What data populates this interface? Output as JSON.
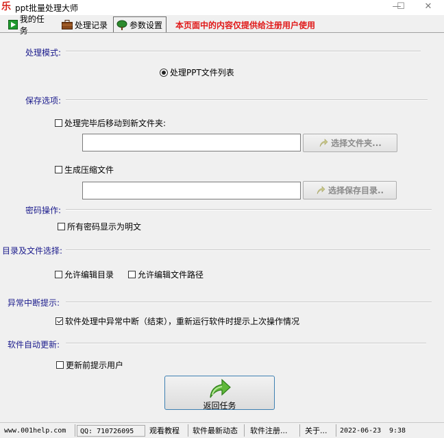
{
  "window": {
    "title": "ppt批量处理大师",
    "icon_glyph": "乐",
    "minimize": "—",
    "maximize": "☐",
    "close": "✕"
  },
  "tabs": [
    {
      "label": "我的任务",
      "icon": "play-icon"
    },
    {
      "label": "处理记录",
      "icon": "briefcase-icon"
    },
    {
      "label": "参数设置",
      "icon": "tree-icon",
      "active": true
    }
  ],
  "notice": "本页面中的内容仅提供给注册用户使用",
  "sections": {
    "mode": {
      "title": "处理模式:",
      "radio_label": "处理PPT文件列表",
      "radio_checked": true
    },
    "save": {
      "title": "保存选项:",
      "move_label": "处理完毕后移动到新文件夹:",
      "move_checked": false,
      "move_path": "",
      "move_button": "选择文件夹...",
      "zip_label": "生成压缩文件",
      "zip_checked": false,
      "zip_path": "",
      "zip_button": "选择保存目录.."
    },
    "password": {
      "title": "密码操作:",
      "plain_label": "所有密码显示为明文",
      "plain_checked": false
    },
    "dir": {
      "title": "目录及文件选择:",
      "edit_dir_label": "允许编辑目录",
      "edit_dir_checked": false,
      "edit_path_label": "允许编辑文件路径",
      "edit_path_checked": false
    },
    "abnormal": {
      "title": "异常中断提示:",
      "notify_label": "软件处理中异常中断（结束），重新运行软件时提示上次操作情况",
      "notify_checked": true
    },
    "update": {
      "title": "软件自动更新:",
      "notify_label": "更新前提示用户",
      "notify_checked": false
    }
  },
  "return_button": "返回任务",
  "statusbar": {
    "website": "www.001help.com",
    "qq": "QQ: 710726095",
    "tutorial": "观看教程",
    "news": "软件最新动态",
    "register": "软件注册...",
    "about": "关于...",
    "date": "2022-06-23",
    "time": "9:38"
  },
  "colors": {
    "notice": "#e01818",
    "section_title": "#1a1a8c",
    "return_border": "#3c7fb1"
  }
}
